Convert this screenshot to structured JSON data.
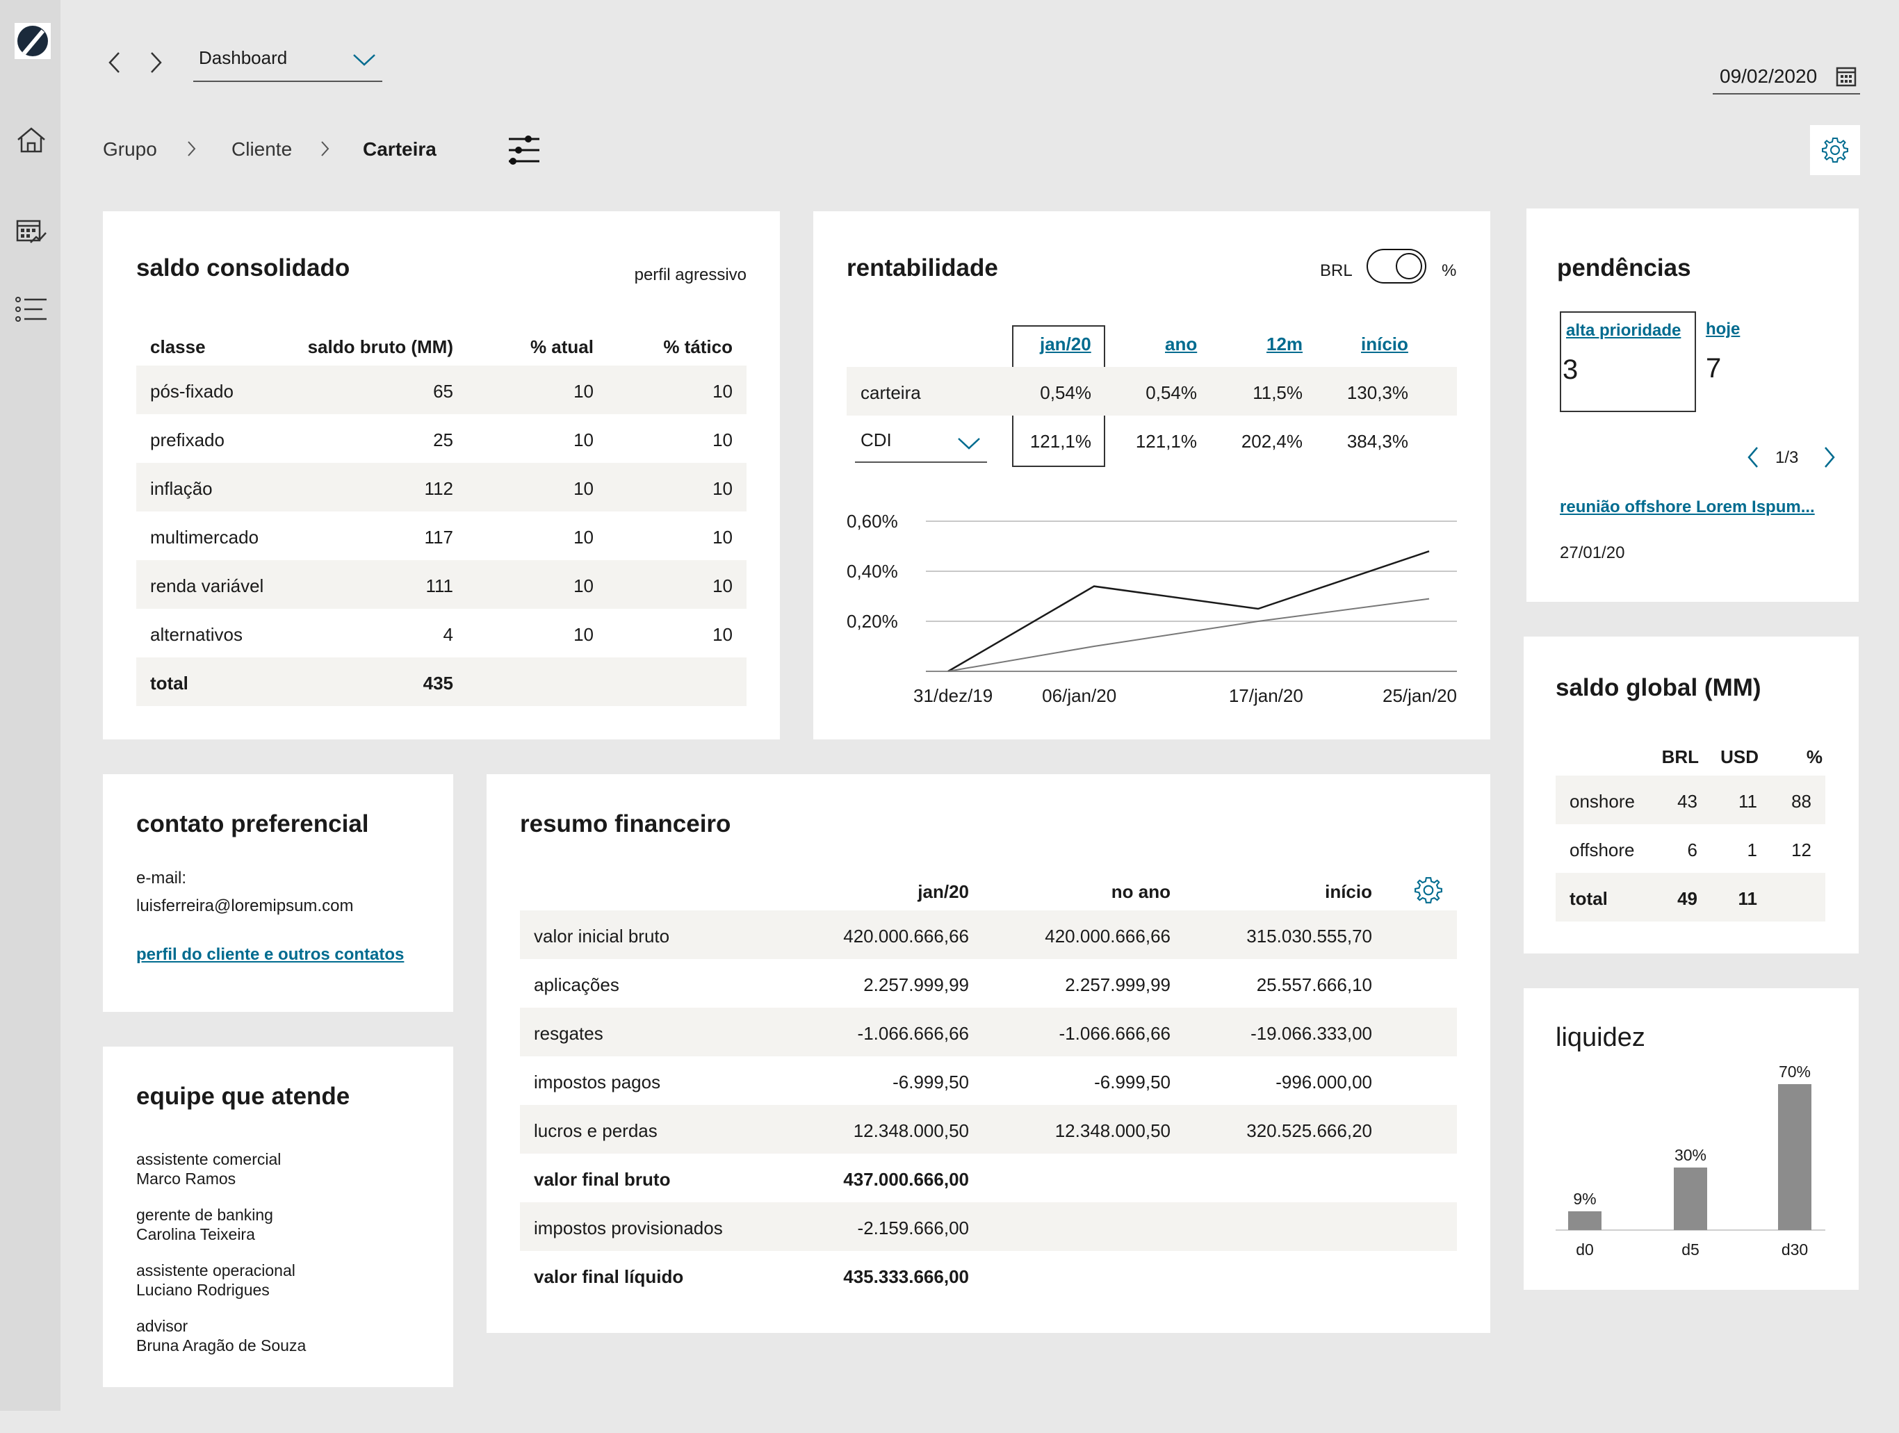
{
  "top": {
    "view_select": "Dashboard",
    "date": "09/02/2020",
    "breadcrumb": [
      "Grupo",
      "Cliente",
      "Carteira"
    ]
  },
  "saldo": {
    "title": "saldo consolidado",
    "profile": "perfil agressivo",
    "headers": [
      "classe",
      "saldo bruto (MM)",
      "% atual",
      "% tático"
    ],
    "rows": [
      [
        "pós-fixado",
        "65",
        "10",
        "10"
      ],
      [
        "prefixado",
        "25",
        "10",
        "10"
      ],
      [
        "inflação",
        "112",
        "10",
        "10"
      ],
      [
        "multimercado",
        "117",
        "10",
        "10"
      ],
      [
        "renda variável",
        "111",
        "10",
        "10"
      ],
      [
        "alternativos",
        "4",
        "10",
        "10"
      ]
    ],
    "total_label": "total",
    "total_value": "435"
  },
  "rent": {
    "title": "rentabilidade",
    "toggle_left": "BRL",
    "toggle_right": "%",
    "periods": [
      "jan/20",
      "ano",
      "12m",
      "início"
    ],
    "rows": [
      {
        "label": "carteira",
        "values": [
          "0,54%",
          "0,54%",
          "11,5%",
          "130,3%"
        ]
      },
      {
        "label": "CDI",
        "values": [
          "121,1%",
          "121,1%",
          "202,4%",
          "384,3%"
        ]
      }
    ],
    "yticks": [
      "0,60%",
      "0,40%",
      "0,20%"
    ],
    "xticks": [
      "31/dez/19",
      "06/jan/20",
      "17/jan/20",
      "25/jan/20"
    ]
  },
  "chart_data": [
    {
      "type": "line",
      "title": "",
      "xlabel": "",
      "ylabel": "",
      "x": [
        "31/dez/19",
        "06/jan/20",
        "17/jan/20",
        "25/jan/20"
      ],
      "ylim": [
        0,
        0.6
      ],
      "grid": true,
      "series": [
        {
          "values": [
            0.0,
            0.34,
            0.25,
            0.48
          ],
          "color": "#1a1a1a"
        },
        {
          "values": [
            0.0,
            0.1,
            0.2,
            0.29
          ],
          "color": "#777777"
        }
      ]
    },
    {
      "type": "bar",
      "title": "liquidez",
      "categories": [
        "d0",
        "d5",
        "d30"
      ],
      "values": [
        9,
        30,
        70
      ],
      "value_labels": [
        "9%",
        "30%",
        "70%"
      ],
      "ylim": [
        0,
        80
      ],
      "color": "#8c8c8c"
    }
  ],
  "pend": {
    "title": "pendências",
    "tab_alta": "alta prioridade",
    "count_alta": "3",
    "tab_hoje": "hoje",
    "count_hoje": "7",
    "pager": "1/3",
    "item_link": "reunião offshore Lorem Ispum...",
    "item_date": "27/01/20"
  },
  "global": {
    "title": "saldo global (MM)",
    "headers": [
      "BRL",
      "USD",
      "%"
    ],
    "rows": [
      [
        "onshore",
        "43",
        "11",
        "88"
      ],
      [
        "offshore",
        "6",
        "1",
        "12"
      ]
    ],
    "total": [
      "total",
      "49",
      "11"
    ]
  },
  "contato": {
    "title": "contato preferencial",
    "email_label": "e-mail:",
    "email": "luisferreira@loremipsum.com",
    "link": "perfil do cliente e outros contatos"
  },
  "equipe": {
    "title": "equipe que atende",
    "members": [
      {
        "role": "assistente comercial",
        "name": "Marco Ramos"
      },
      {
        "role": "gerente de banking",
        "name": "Carolina Teixeira"
      },
      {
        "role": "assistente operacional",
        "name": "Luciano Rodrigues"
      },
      {
        "role": "advisor",
        "name": "Bruna Aragão de Souza"
      }
    ]
  },
  "resumo": {
    "title": "resumo financeiro",
    "headers": [
      "jan/20",
      "no ano",
      "início"
    ],
    "rows": [
      {
        "label": "valor inicial bruto",
        "values": [
          "420.000.666,66",
          "420.000.666,66",
          "315.030.555,70"
        ]
      },
      {
        "label": "aplicações",
        "values": [
          "2.257.999,99",
          "2.257.999,99",
          "25.557.666,10"
        ]
      },
      {
        "label": "resgates",
        "values": [
          "-1.066.666,66",
          "-1.066.666,66",
          "-19.066.333,00"
        ]
      },
      {
        "label": "impostos pagos",
        "values": [
          "-6.999,50",
          "-6.999,50",
          "-996.000,00"
        ]
      },
      {
        "label": "lucros e perdas",
        "values": [
          "12.348.000,50",
          "12.348.000,50",
          "320.525.666,20"
        ]
      },
      {
        "label": "valor final bruto",
        "values": [
          "437.000.666,00",
          "",
          ""
        ]
      },
      {
        "label": "impostos provisionados",
        "values": [
          "-2.159.666,00",
          "",
          ""
        ]
      },
      {
        "label": "valor final líquido",
        "values": [
          "435.333.666,00",
          "",
          ""
        ]
      }
    ]
  },
  "liquidez": {
    "title": "liquidez"
  }
}
